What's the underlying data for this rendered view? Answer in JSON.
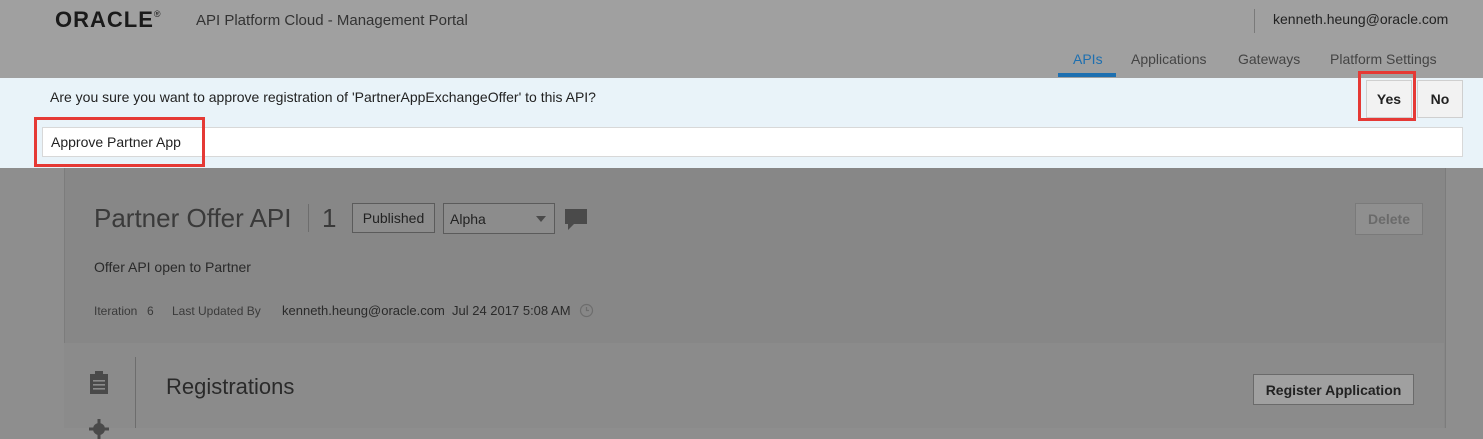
{
  "header": {
    "logo": "ORACLE",
    "logo_mark": "®",
    "app_title": "API Platform Cloud - Management Portal",
    "user": "kenneth.heung@oracle.com",
    "nav": [
      {
        "label": "APIs",
        "active": true
      },
      {
        "label": "Applications",
        "active": false
      },
      {
        "label": "Gateways",
        "active": false
      },
      {
        "label": "Platform Settings",
        "active": false
      }
    ]
  },
  "confirm": {
    "message": "Are you sure you want to approve registration of 'PartnerAppExchangeOffer' to this API?",
    "yes_label": "Yes",
    "no_label": "No",
    "reason_value": "Approve Partner App"
  },
  "api": {
    "name": "Partner Offer API",
    "version": "1",
    "state": "Published",
    "stage": "Alpha",
    "delete_label": "Delete",
    "description": "Offer API open to Partner",
    "iteration_label": "Iteration",
    "iteration_value": "6",
    "updated_by_label": "Last Updated By",
    "updated_by_value": "kenneth.heung@oracle.com",
    "updated_at": "Jul 24 2017 5:08 AM"
  },
  "registrations": {
    "title": "Registrations",
    "register_label": "Register Application"
  },
  "icons": {
    "comment": "comment-icon",
    "clock": "clock-icon",
    "document": "document-icon",
    "gear": "gear-icon"
  },
  "colors": {
    "accent": "#1d6fb0",
    "highlight": "#e53935",
    "confirm_bg": "#e9f3f9"
  }
}
